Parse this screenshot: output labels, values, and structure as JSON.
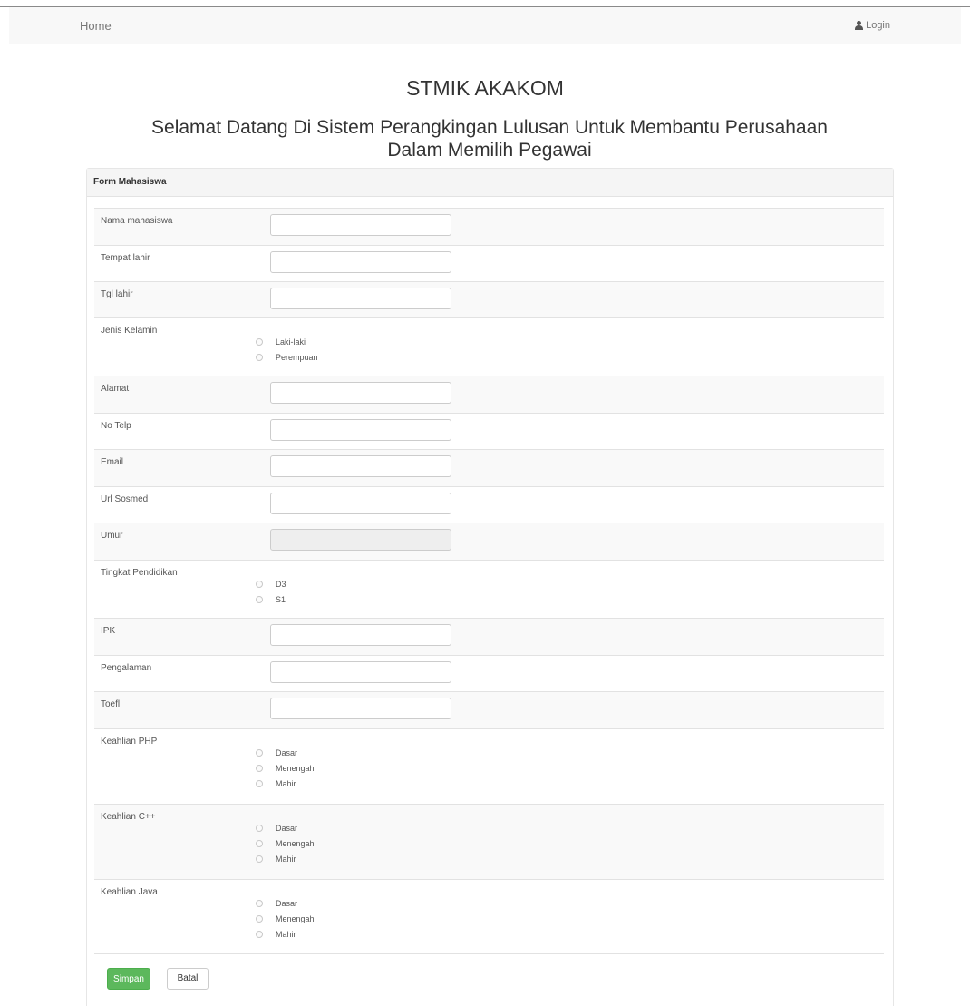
{
  "nav": {
    "home": "Home",
    "login": "Login",
    "login_icon": "user-icon"
  },
  "header": {
    "title": "STMIK AKAKOM",
    "subtitle_line1": "Selamat Datang Di Sistem Perangkingan Lulusan Untuk Membantu Perusahaan",
    "subtitle_line2": "Dalam Memilih Pegawai"
  },
  "form": {
    "heading": "Form Mahasiswa",
    "fields": {
      "nama": {
        "label": "Nama mahasiswa",
        "value": ""
      },
      "tempat_lahir": {
        "label": "Tempat lahir",
        "value": ""
      },
      "tgl_lahir": {
        "label": "Tgl lahir",
        "value": ""
      },
      "jenis_kelamin": {
        "label": "Jenis Kelamin",
        "options": [
          "Laki-laki",
          "Perempuan"
        ]
      },
      "alamat": {
        "label": "Alamat",
        "value": ""
      },
      "no_telp": {
        "label": "No Telp",
        "value": ""
      },
      "email": {
        "label": "Email",
        "value": ""
      },
      "url_sosmed": {
        "label": "Url Sosmed",
        "value": ""
      },
      "umur": {
        "label": "Umur",
        "value": "",
        "disabled": true
      },
      "tingkat_pendidikan": {
        "label": "Tingkat Pendidikan",
        "options": [
          "D3",
          "S1"
        ]
      },
      "ipk": {
        "label": "IPK",
        "value": ""
      },
      "pengalaman": {
        "label": "Pengalaman",
        "value": ""
      },
      "toefl": {
        "label": "Toefl",
        "value": ""
      },
      "keahlian_php": {
        "label": "Keahlian PHP",
        "options": [
          "Dasar",
          "Menengah",
          "Mahir"
        ]
      },
      "keahlian_cpp": {
        "label": "Keahlian C++",
        "options": [
          "Dasar",
          "Menengah",
          "Mahir"
        ]
      },
      "keahlian_java": {
        "label": "Keahlian Java",
        "options": [
          "Dasar",
          "Menengah",
          "Mahir"
        ]
      }
    },
    "buttons": {
      "save": "Simpan",
      "cancel": "Batal"
    }
  },
  "colors": {
    "save_button": "#5cb85c",
    "navbar_bg": "#f8f8f8",
    "stripe": "#f9f9f9"
  }
}
